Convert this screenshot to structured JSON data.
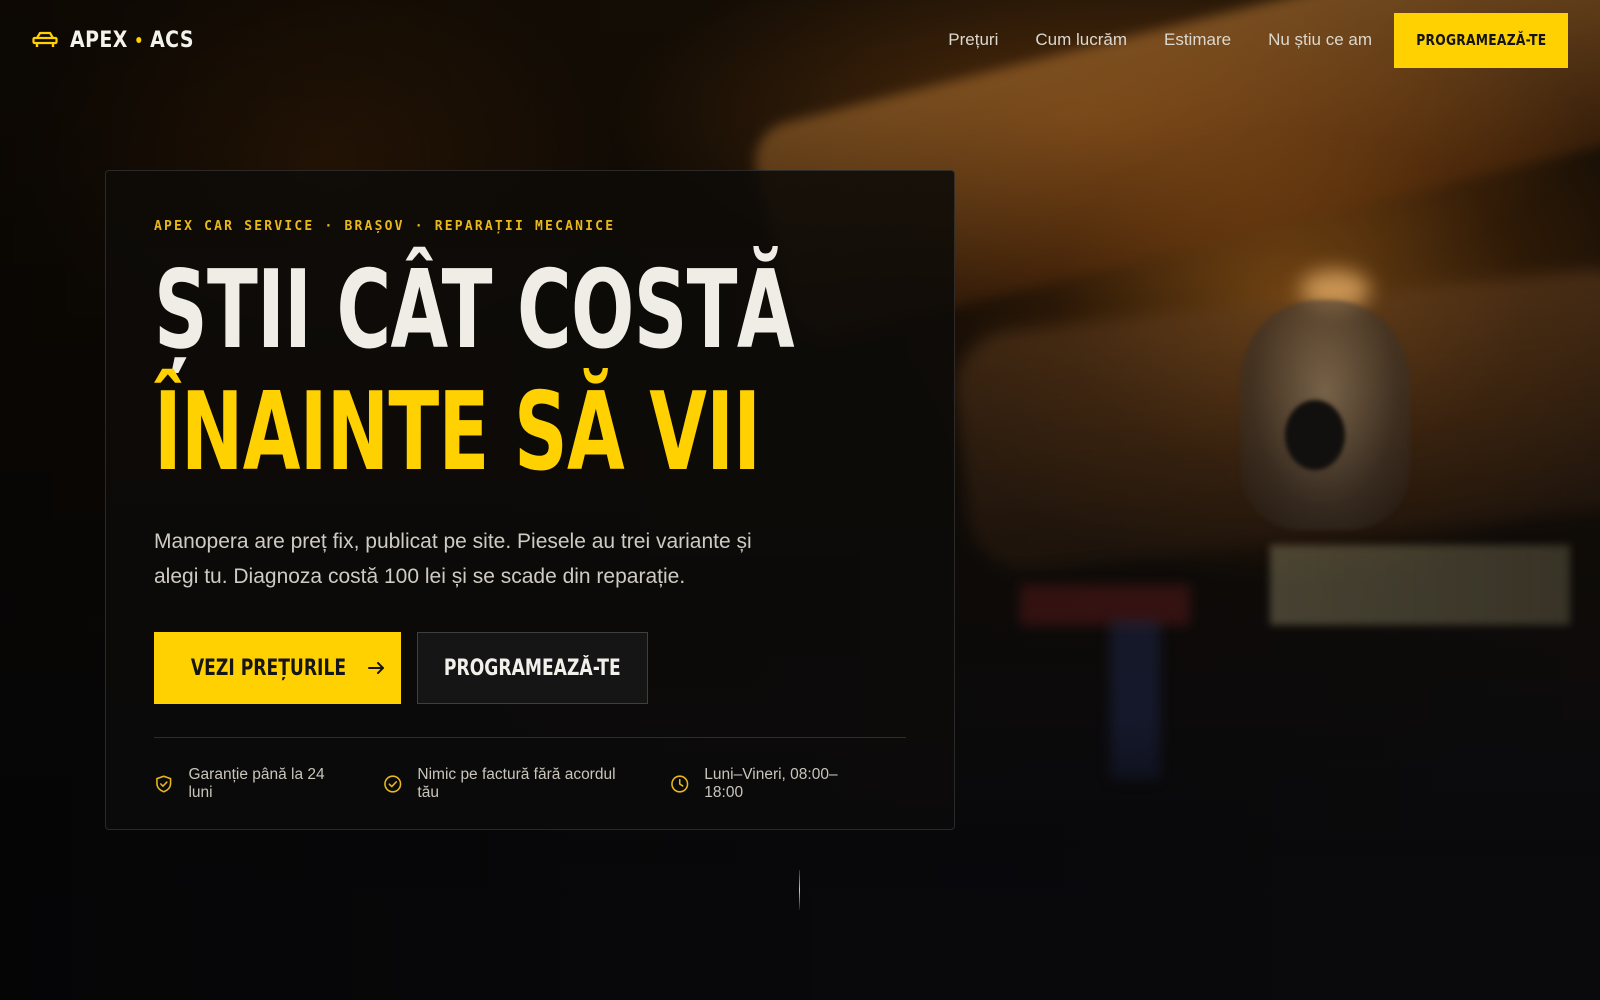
{
  "brand": {
    "name_left": "APEX",
    "name_right": "ACS",
    "icon": "car-icon",
    "accent_color": "#ffd100"
  },
  "nav": {
    "links": [
      "Prețuri",
      "Cum lucrăm",
      "Estimare",
      "Nu știu ce am"
    ],
    "cta_label": "PROGRAMEAZĂ-TE"
  },
  "hero": {
    "eyebrow": "APEX CAR SERVICE · BRAȘOV · REPARAȚII MECANICE",
    "headline_line1": "ȘTII CÂT COSTĂ",
    "headline_line2": "ÎNAINTE SĂ VII",
    "lead": "Manopera are preț fix, publicat pe site. Piesele au trei variante și alegi tu. Diagnoza costă 100 lei și se scade din reparație.",
    "primary_button": "VEZI PREȚURILE",
    "primary_button_icon": "arrow-right-icon",
    "secondary_button": "PROGRAMEAZĂ-TE",
    "features": [
      {
        "icon": "shield-check-icon",
        "label": "Garanție până la 24 luni"
      },
      {
        "icon": "check-circle-icon",
        "label": "Nimic pe factură fără acordul tău"
      },
      {
        "icon": "clock-icon",
        "label": "Luni–Vineri, 08:00–18:00"
      }
    ]
  }
}
